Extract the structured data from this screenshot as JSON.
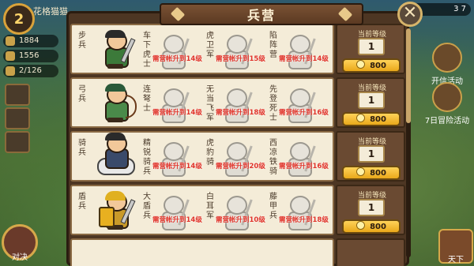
{
  "hud": {
    "level": "2",
    "player_name": "花格猫猫",
    "stats": [
      "1884",
      "1556",
      "2/126"
    ],
    "top_right": "3 7",
    "right_events": [
      "开信活动",
      "7日冒险活动"
    ],
    "bottom_left": "对决",
    "bottom_right": "天下"
  },
  "panel": {
    "title": "兵营",
    "close_label": "✕"
  },
  "rows": [
    {
      "category": "步兵",
      "upgrades": [
        {
          "name": "车下虎士",
          "req": "需营帐升到14级"
        },
        {
          "name": "虎卫军",
          "req": "需营帐升到15级"
        },
        {
          "name": "陷阵营",
          "req": "需营帐升到14级"
        }
      ],
      "level_label": "当前等级",
      "level": "1",
      "cost": "800"
    },
    {
      "category": "弓兵",
      "upgrades": [
        {
          "name": "连弩士",
          "req": "需营帐升到14级"
        },
        {
          "name": "无当飞军",
          "req": "需营帐升到18级"
        },
        {
          "name": "先登死士",
          "req": "需营帐升到16级"
        }
      ],
      "level_label": "当前等级",
      "level": "1",
      "cost": "800"
    },
    {
      "category": "骑兵",
      "upgrades": [
        {
          "name": "精锐骑兵",
          "req": "需营帐升到14级"
        },
        {
          "name": "虎豹骑",
          "req": "需营帐升到20级"
        },
        {
          "name": "西凉铁骑",
          "req": "需营帐升到16级"
        }
      ],
      "level_label": "当前等级",
      "level": "1",
      "cost": "800"
    },
    {
      "category": "盾兵",
      "upgrades": [
        {
          "name": "大盾兵",
          "req": "需营帐升到14级"
        },
        {
          "name": "白耳军",
          "req": "需营帐升到10级"
        },
        {
          "name": "藤甲兵",
          "req": "需营帐升到18级"
        }
      ],
      "level_label": "当前等级",
      "level": "1",
      "cost": "800"
    }
  ],
  "colors": {
    "card_bg": "#f4ecd8",
    "req_red": "#e0342a",
    "gold": "#ffd35a",
    "panel_brown": "#4d3623"
  }
}
